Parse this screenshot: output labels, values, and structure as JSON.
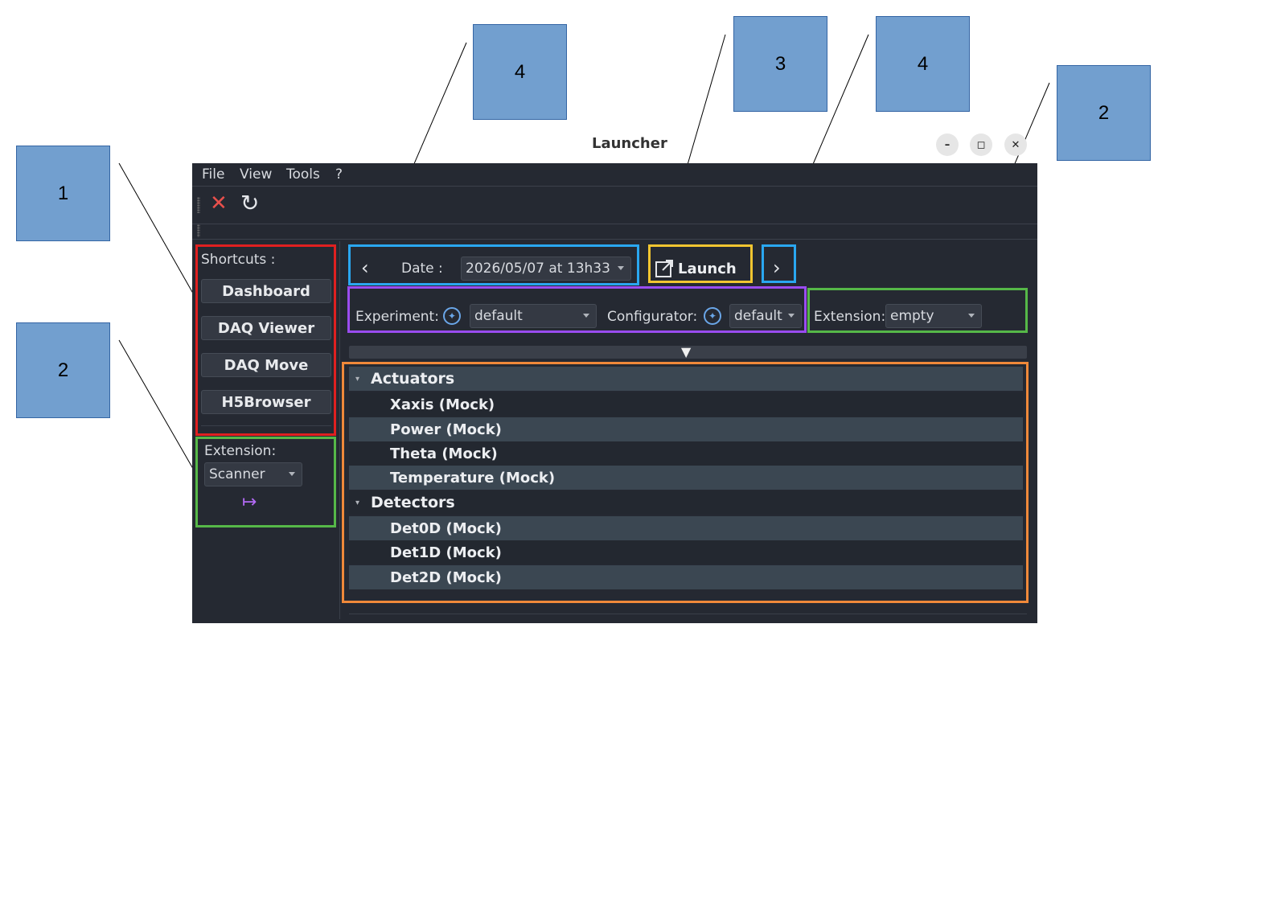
{
  "callouts": [
    "1",
    "2",
    "4",
    "3",
    "4",
    "2"
  ],
  "window": {
    "title": "Launcher",
    "controls": {
      "minimize": "–",
      "maximize": "◻",
      "close": "✕"
    }
  },
  "menu": [
    "File",
    "View",
    "Tools",
    "?"
  ],
  "toolbar": {
    "stop_icon": "✕",
    "refresh_icon": "↻"
  },
  "shortcuts": {
    "label": "Shortcuts :",
    "buttons": [
      "Dashboard",
      "DAQ Viewer",
      "DAQ Move",
      "H5Browser"
    ]
  },
  "left_extension": {
    "label": "Extension:",
    "value": "Scanner",
    "launch_icon": "↦"
  },
  "date_nav": {
    "prev": "‹",
    "label": "Date :",
    "value": "2026/05/07 at 13h33",
    "next": "›"
  },
  "launch": {
    "label": "Launch",
    "icon": "external-link-icon"
  },
  "experiment": {
    "label": "Experiment:",
    "value": "default"
  },
  "configurator": {
    "label": "Configurator:",
    "value": "default"
  },
  "top_extension": {
    "label": "Extension:",
    "value": "empty"
  },
  "expander": {
    "icon": "▼"
  },
  "tree": {
    "groups": [
      {
        "name": "Actuators",
        "items": [
          "Xaxis (Mock)",
          "Power (Mock)",
          "Theta (Mock)",
          "Temperature (Mock)"
        ]
      },
      {
        "name": "Detectors",
        "items": [
          "Det0D (Mock)",
          "Det1D (Mock)",
          "Det2D (Mock)"
        ]
      }
    ]
  },
  "colors": {
    "callout_fill": "#729fcf",
    "annotation_red": "#e02020",
    "annotation_green": "#56b848",
    "annotation_blue": "#2aa7f0",
    "annotation_yellow": "#f2c530",
    "annotation_purple": "#9a4cf0",
    "annotation_orange": "#f0893a",
    "window_bg": "#252932"
  }
}
